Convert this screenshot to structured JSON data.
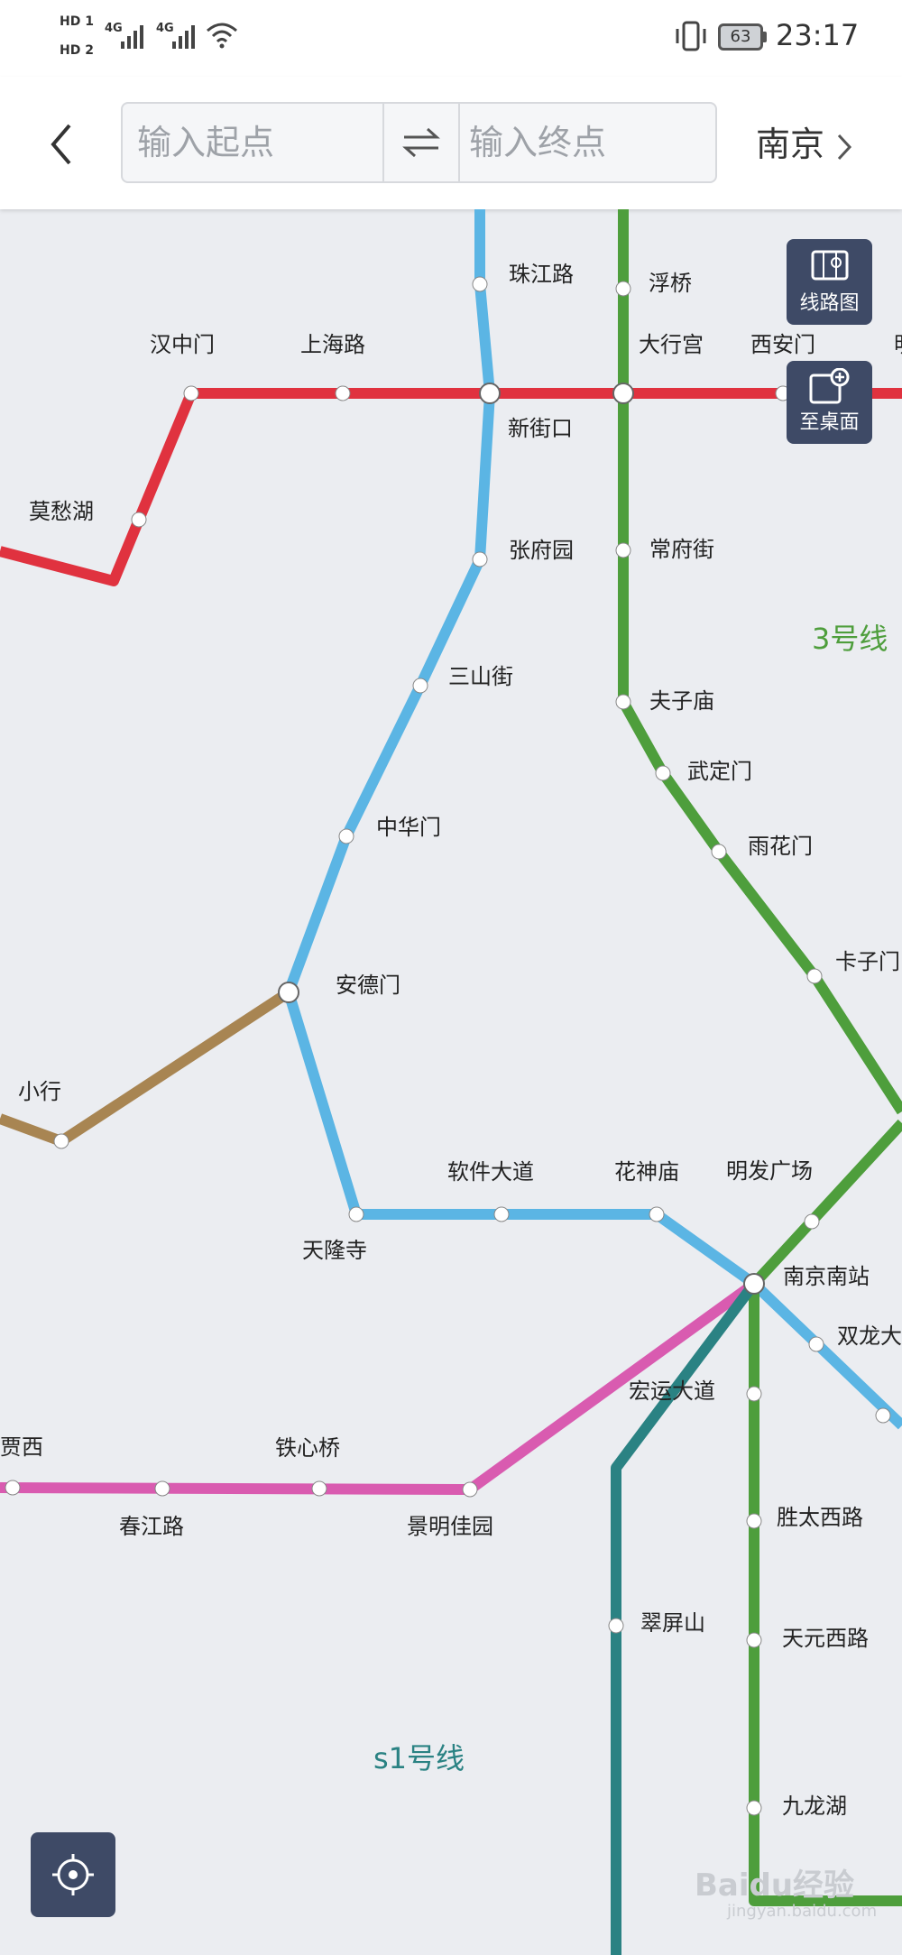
{
  "status_bar": {
    "hd1": "HD 1",
    "hd2": "HD 2",
    "network1": "4G",
    "network2": "4G",
    "battery": "63",
    "time": "23:17"
  },
  "header": {
    "back_icon": "chevron-left-icon",
    "start_placeholder": "输入起点",
    "end_placeholder": "输入终点",
    "swap_icon": "swap-icon",
    "city": "南京"
  },
  "buttons": {
    "line_map": "线路图",
    "to_desktop": "至桌面",
    "locate_icon": "locate-icon"
  },
  "line_labels": {
    "line3": "3号线",
    "s1": "s1号线"
  },
  "colors": {
    "line1": "#e0323f",
    "line2": "#5bb5e4",
    "line3": "#4e9e3c",
    "line10": "#a88552",
    "s1": "#2a8283",
    "s3": "#d95bb0"
  },
  "stations": {
    "zhujianglu": "珠江路",
    "fuqiao": "浮桥",
    "hanzhongmen": "汉中门",
    "shanghailu": "上海路",
    "daxinggong": "大行宫",
    "xianmen": "西安门",
    "mingguang": "明",
    "xinjiekou": "新街口",
    "mochouhu": "莫愁湖",
    "zhangfuyuan": "张府园",
    "changfujie": "常府街",
    "sanshanjie": "三山街",
    "fuzimiao": "夫子庙",
    "wudingmen": "武定门",
    "zhonghuamen": "中华门",
    "yuhuamen": "雨花门",
    "kazimen": "卡子门",
    "andemen": "安德门",
    "xiaohang": "小行",
    "ruanjiandadao": "软件大道",
    "huashenmiao": "花神庙",
    "mingfaguangchang": "明发广场",
    "tianlongsi": "天隆寺",
    "nanjingnanzhan": "南京南站",
    "shuanglongdadao": "双龙大",
    "hongyundadao": "宏运大道",
    "jiaxi": "贾西",
    "tiexinqiao": "铁心桥",
    "chunjianglu": "春江路",
    "jingmingjiayuan": "景明佳园",
    "shengtaixilu": "胜太西路",
    "cuipingshan": "翠屏山",
    "tianyuanxilu": "天元西路",
    "jiulonghu": "九龙湖"
  },
  "watermark": {
    "text": "Baidu经验",
    "sub": "jingyan.baidu.com"
  }
}
